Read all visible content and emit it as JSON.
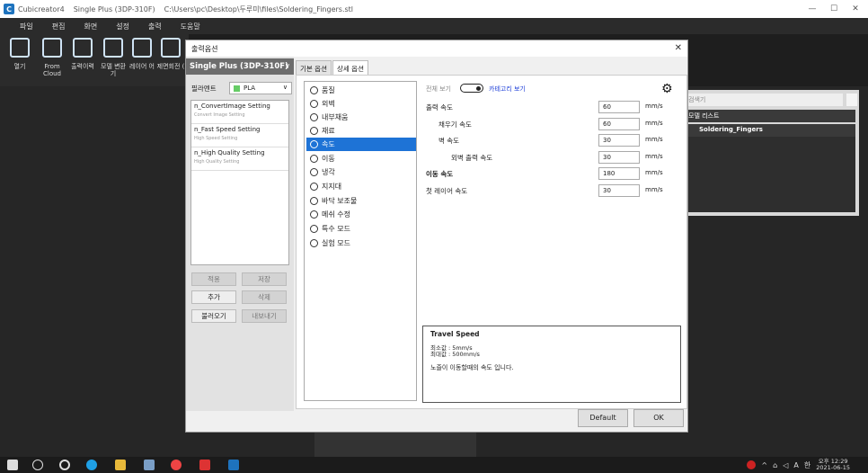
{
  "window": {
    "app": "Cubicreator4",
    "printer": "Single Plus (3DP-310F)",
    "path": "C:\\Users\\pc\\Desktop\\두루미\\files\\Soldering_Fingers.stl",
    "min": "—",
    "max": "☐",
    "close": "✕"
  },
  "menu": [
    "파일",
    "편집",
    "화면",
    "설정",
    "출력",
    "도움말"
  ],
  "toolbar": [
    {
      "label": "열기",
      "icon": "folder-icon"
    },
    {
      "label": "From Cloud",
      "icon": "cloud-icon"
    },
    {
      "label": "출력이력",
      "icon": "list-icon"
    },
    {
      "label": "모델 변환 기",
      "icon": "transform-icon"
    },
    {
      "label": "레이어 어",
      "icon": "layers-icon"
    },
    {
      "label": "제면회전 (",
      "icon": "rotate-icon"
    }
  ],
  "right_panel": {
    "search": "검색기",
    "header": "모델 리스트",
    "item": "Soldering_Fingers"
  },
  "dialog": {
    "title": "출력옵션",
    "close": "✕",
    "printer": "Single Plus (3DP-310F)",
    "printer_chevron": "∨",
    "filament_label": "필라멘트",
    "filament_value": "PLA",
    "filament_chevron": "∨",
    "profiles": [
      {
        "name": "n_ConvertImage Setting",
        "sub": "Convert Image Setting"
      },
      {
        "name": "n_Fast Speed Setting",
        "sub": "High Speed Setting"
      },
      {
        "name": "n_High Quality Setting",
        "sub": "High Quality Setting"
      }
    ],
    "buttons": {
      "apply": "적용",
      "save": "저장",
      "add": "추가",
      "delete": "삭제",
      "import": "불러오기",
      "export": "내보내기"
    },
    "tabs": [
      "기본 옵션",
      "상세 옵션"
    ],
    "categories": [
      "품질",
      "외벽",
      "내부채움",
      "재료",
      "속도",
      "이동",
      "냉각",
      "지지대",
      "바닥 보조물",
      "메쉬 수정",
      "특수 모드",
      "실험 모드"
    ],
    "selected_category": "속도",
    "view_all": "전체 보기",
    "category_view": "카테고리 보기",
    "gear": "⚙",
    "settings": [
      {
        "label": "출력 속도",
        "value": "60",
        "unit": "mm/s",
        "indent": 0,
        "bold": false
      },
      {
        "label": "채우기 속도",
        "value": "60",
        "unit": "mm/s",
        "indent": 1,
        "bold": false
      },
      {
        "label": "벽 속도",
        "value": "30",
        "unit": "mm/s",
        "indent": 1,
        "bold": false
      },
      {
        "label": "외벽 출력 속도",
        "value": "30",
        "unit": "mm/s",
        "indent": 2,
        "bold": false
      },
      {
        "label": "이동 속도",
        "value": "180",
        "unit": "mm/s",
        "indent": 0,
        "bold": true
      },
      {
        "label": "첫 레이어 속도",
        "value": "30",
        "unit": "mm/s",
        "indent": 0,
        "bold": false
      }
    ],
    "description": {
      "title": "Travel Speed",
      "min": "최소값 : 5mm/s",
      "max": "최대값 : 500mm/s",
      "text": "노즐이 이동할때의 속도 입니다."
    },
    "footer": {
      "default": "Default",
      "ok": "OK"
    }
  },
  "taskbar": {
    "time": "오후 12:29",
    "date": "2021-06-15",
    "lang": "A",
    "ime": "한"
  }
}
